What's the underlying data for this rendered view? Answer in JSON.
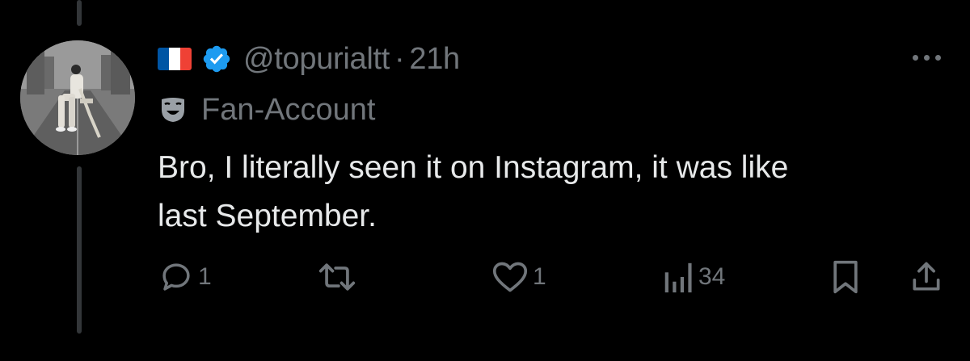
{
  "tweet": {
    "flag_icon": "france-flag-icon",
    "flag_colors": [
      "#0055a4",
      "#ffffff",
      "#ef4135"
    ],
    "verified_color": "#1d9bf0",
    "handle": "@topurialtt",
    "separator": "·",
    "time": "21h",
    "label": "Fan-Account",
    "label_icon": "theater-mask-icon",
    "text_line1": "Bro, I literally seen it on Instagram, it was like",
    "text_line2": "last September."
  },
  "actions": {
    "replies": "1",
    "reposts": "",
    "likes": "1",
    "views": "34"
  },
  "colors": {
    "background": "#000000",
    "primary_text": "#e7e9ea",
    "secondary_text": "#71767b",
    "thread_line": "#333639"
  }
}
